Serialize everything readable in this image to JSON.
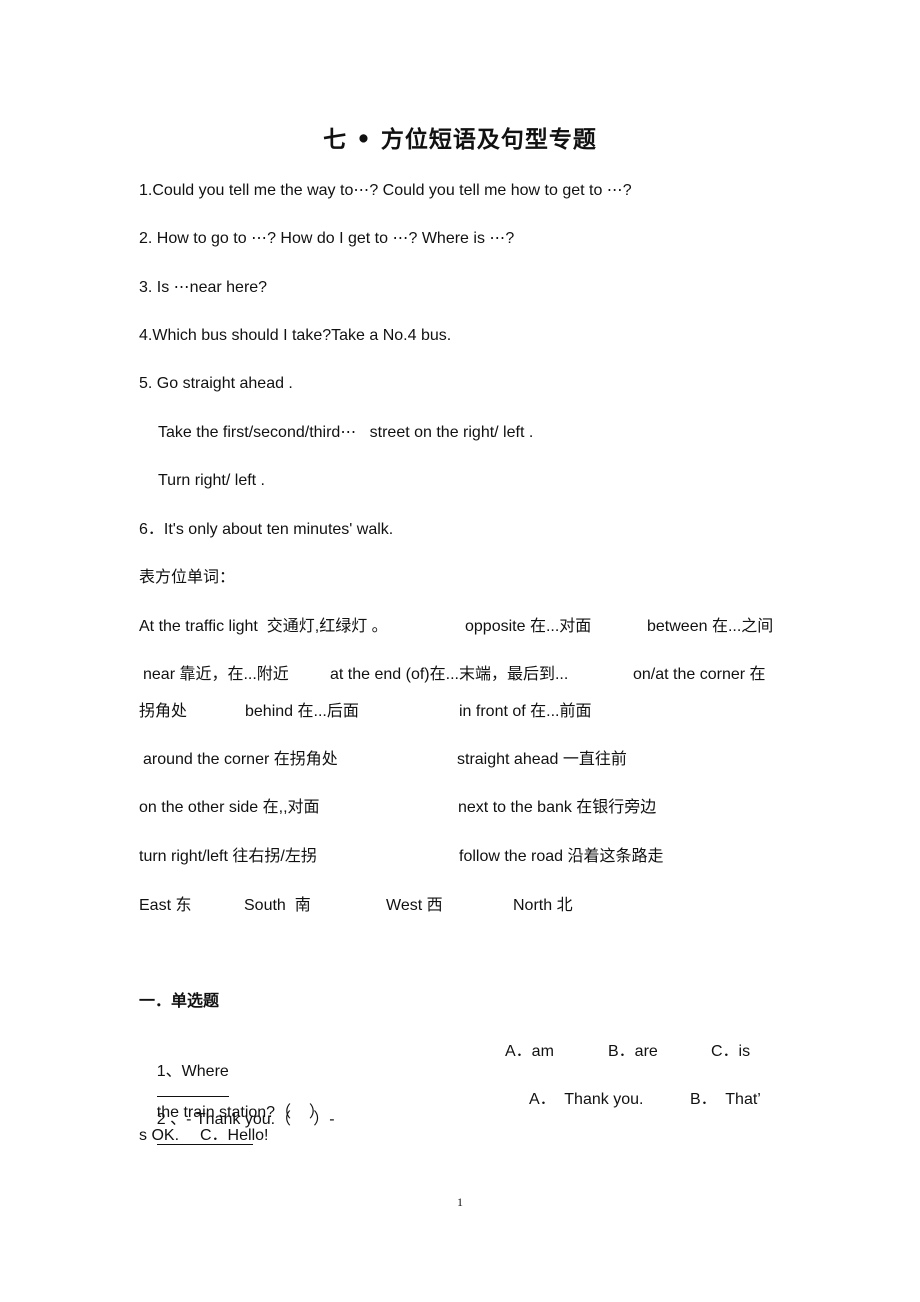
{
  "title": "七 • 方位短语及句型专题",
  "sentences": {
    "s1": "1.Could you tell me the way to⋯? Could you tell me how to get to ⋯?",
    "s2": "2. How to go to ⋯? How do I get to ⋯? Where is ⋯?",
    "s3": "3. Is ⋯near here?",
    "s4": "4.Which bus should I take?Take a No.4 bus.",
    "s5": "5. Go straight ahead .",
    "s5a": "Take the first/second/third⋯   street on the right/ left .",
    "s5b": "Turn right/ left .",
    "s6": "6．It's only about ten minutes' walk."
  },
  "vocab_heading": "表方位单词：",
  "vocab": {
    "traffic_light": "At the traffic light  交通灯,红绿灯 。",
    "opposite": "opposite 在...对面",
    "between": "between 在...之间",
    "near": "near 靠近，在...附近",
    "at_the_end": "at the end (of)在...末端，最后到...",
    "on_at_corner": "on/at the corner 在",
    "on_at_corner_cont": "拐角处",
    "behind": "behind 在...后面",
    "in_front_of": "in front of 在...前面",
    "around_corner": "around the corner 在拐角处",
    "straight_ahead": "straight ahead 一直往前",
    "other_side": "on the other side 在,,对面",
    "next_to_bank": "next to the bank 在银行旁边",
    "turn": "turn right/left 往右拐/左拐",
    "follow_road": "follow the road 沿着这条路走",
    "east": "East 东",
    "south": "South  南",
    "west": "West 西",
    "north": "North 北"
  },
  "section": {
    "heading": "一．单选题",
    "q1": {
      "prefix": "1、Where",
      "suffix": "the train station?（    ）",
      "options": [
        "A．am",
        "B．are",
        "C．is"
      ]
    },
    "q2": {
      "prefix": "2 、- Thank you.（     ）-",
      "options": [
        "A．  Thank you.",
        "B．  That’",
        "s OK.",
        "C．Hello!"
      ]
    }
  },
  "page_number": "1"
}
